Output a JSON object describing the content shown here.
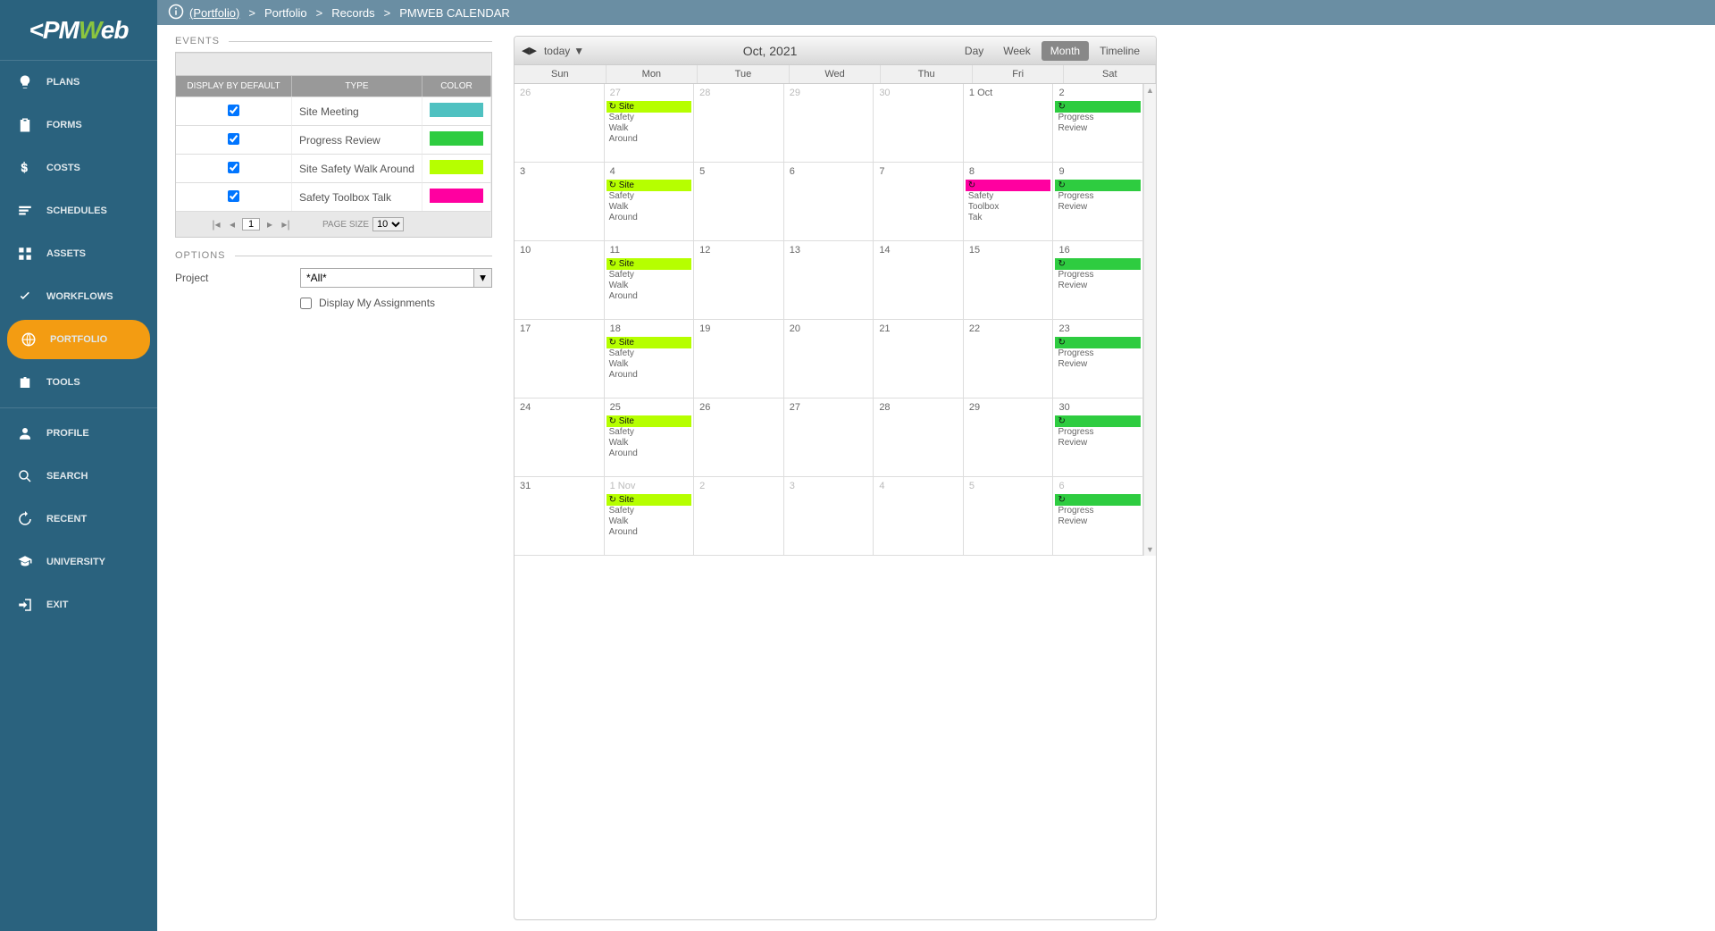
{
  "sidebar": {
    "items": [
      {
        "label": "PLANS",
        "icon": "bulb"
      },
      {
        "label": "FORMS",
        "icon": "clipboard"
      },
      {
        "label": "COSTS",
        "icon": "dollar"
      },
      {
        "label": "SCHEDULES",
        "icon": "bars"
      },
      {
        "label": "ASSETS",
        "icon": "grid"
      },
      {
        "label": "WORKFLOWS",
        "icon": "check"
      },
      {
        "label": "PORTFOLIO",
        "icon": "globe",
        "active": true
      },
      {
        "label": "TOOLS",
        "icon": "briefcase"
      }
    ],
    "bottom": [
      {
        "label": "PROFILE",
        "icon": "user"
      },
      {
        "label": "SEARCH",
        "icon": "search"
      },
      {
        "label": "RECENT",
        "icon": "history"
      },
      {
        "label": "UNIVERSITY",
        "icon": "gradcap"
      },
      {
        "label": "EXIT",
        "icon": "exit"
      }
    ]
  },
  "breadcrumb": {
    "root": "(Portfolio)",
    "parts": [
      "Portfolio",
      "Records",
      "PMWEB CALENDAR"
    ]
  },
  "events_section": {
    "title": "EVENTS",
    "columns": {
      "c1": "DISPLAY BY DEFAULT",
      "c2": "TYPE",
      "c3": "COLOR"
    },
    "rows": [
      {
        "checked": true,
        "type": "Site Meeting",
        "color": "#4fc1c1"
      },
      {
        "checked": true,
        "type": "Progress Review",
        "color": "#2ecc40"
      },
      {
        "checked": true,
        "type": "Site Safety Walk Around",
        "color": "#b6ff00"
      },
      {
        "checked": true,
        "type": "Safety Toolbox Talk",
        "color": "#ff00a0"
      }
    ],
    "pager": {
      "page": "1",
      "page_size_label": "PAGE SIZE",
      "page_size": "10"
    }
  },
  "options_section": {
    "title": "OPTIONS",
    "project_label": "Project",
    "project_value": "*All*",
    "assignments_label": "Display My Assignments"
  },
  "calendar": {
    "today_label": "today",
    "title": "Oct, 2021",
    "views": {
      "day": "Day",
      "week": "Week",
      "month": "Month",
      "timeline": "Timeline"
    },
    "active_view": "month",
    "day_headers": [
      "Sun",
      "Mon",
      "Tue",
      "Wed",
      "Thu",
      "Fri",
      "Sat"
    ],
    "weeks": [
      [
        {
          "n": "26",
          "other": true
        },
        {
          "n": "27",
          "other": true,
          "events": [
            {
              "bar": "#b6ff00",
              "label": "Site"
            },
            {
              "text": "Safety"
            },
            {
              "text": "Walk"
            },
            {
              "text": "Around"
            }
          ]
        },
        {
          "n": "28",
          "other": true
        },
        {
          "n": "29",
          "other": true
        },
        {
          "n": "30",
          "other": true
        },
        {
          "n": "1 Oct"
        },
        {
          "n": "2",
          "events": [
            {
              "bar": "#2ecc40",
              "label": ""
            },
            {
              "text": "Progress"
            },
            {
              "text": "Review"
            }
          ]
        }
      ],
      [
        {
          "n": "3"
        },
        {
          "n": "4",
          "events": [
            {
              "bar": "#b6ff00",
              "label": "Site"
            },
            {
              "text": "Safety"
            },
            {
              "text": "Walk"
            },
            {
              "text": "Around"
            }
          ]
        },
        {
          "n": "5"
        },
        {
          "n": "6"
        },
        {
          "n": "7"
        },
        {
          "n": "8",
          "events": [
            {
              "bar": "#ff00a0",
              "label": ""
            },
            {
              "text": "Safety"
            },
            {
              "text": "Toolbox"
            },
            {
              "text": "Tak"
            }
          ]
        },
        {
          "n": "9",
          "events": [
            {
              "bar": "#2ecc40",
              "label": ""
            },
            {
              "text": "Progress"
            },
            {
              "text": "Review"
            }
          ]
        }
      ],
      [
        {
          "n": "10"
        },
        {
          "n": "11",
          "events": [
            {
              "bar": "#b6ff00",
              "label": "Site"
            },
            {
              "text": "Safety"
            },
            {
              "text": "Walk"
            },
            {
              "text": "Around"
            }
          ]
        },
        {
          "n": "12"
        },
        {
          "n": "13"
        },
        {
          "n": "14"
        },
        {
          "n": "15"
        },
        {
          "n": "16",
          "events": [
            {
              "bar": "#2ecc40",
              "label": ""
            },
            {
              "text": "Progress"
            },
            {
              "text": "Review"
            }
          ]
        }
      ],
      [
        {
          "n": "17"
        },
        {
          "n": "18",
          "events": [
            {
              "bar": "#b6ff00",
              "label": "Site"
            },
            {
              "text": "Safety"
            },
            {
              "text": "Walk"
            },
            {
              "text": "Around"
            }
          ]
        },
        {
          "n": "19"
        },
        {
          "n": "20"
        },
        {
          "n": "21"
        },
        {
          "n": "22"
        },
        {
          "n": "23",
          "events": [
            {
              "bar": "#2ecc40",
              "label": ""
            },
            {
              "text": "Progress"
            },
            {
              "text": "Review"
            }
          ]
        }
      ],
      [
        {
          "n": "24"
        },
        {
          "n": "25",
          "events": [
            {
              "bar": "#b6ff00",
              "label": "Site"
            },
            {
              "text": "Safety"
            },
            {
              "text": "Walk"
            },
            {
              "text": "Around"
            }
          ]
        },
        {
          "n": "26"
        },
        {
          "n": "27"
        },
        {
          "n": "28"
        },
        {
          "n": "29"
        },
        {
          "n": "30",
          "events": [
            {
              "bar": "#2ecc40",
              "label": ""
            },
            {
              "text": "Progress"
            },
            {
              "text": "Review"
            }
          ]
        }
      ],
      [
        {
          "n": "31"
        },
        {
          "n": "1 Nov",
          "other": true,
          "events": [
            {
              "bar": "#b6ff00",
              "label": "Site"
            },
            {
              "text": "Safety"
            },
            {
              "text": "Walk"
            },
            {
              "text": "Around"
            }
          ]
        },
        {
          "n": "2",
          "other": true
        },
        {
          "n": "3",
          "other": true
        },
        {
          "n": "4",
          "other": true
        },
        {
          "n": "5",
          "other": true
        },
        {
          "n": "6",
          "other": true,
          "events": [
            {
              "bar": "#2ecc40",
              "label": ""
            },
            {
              "text": "Progress"
            },
            {
              "text": "Review"
            }
          ]
        }
      ]
    ]
  }
}
